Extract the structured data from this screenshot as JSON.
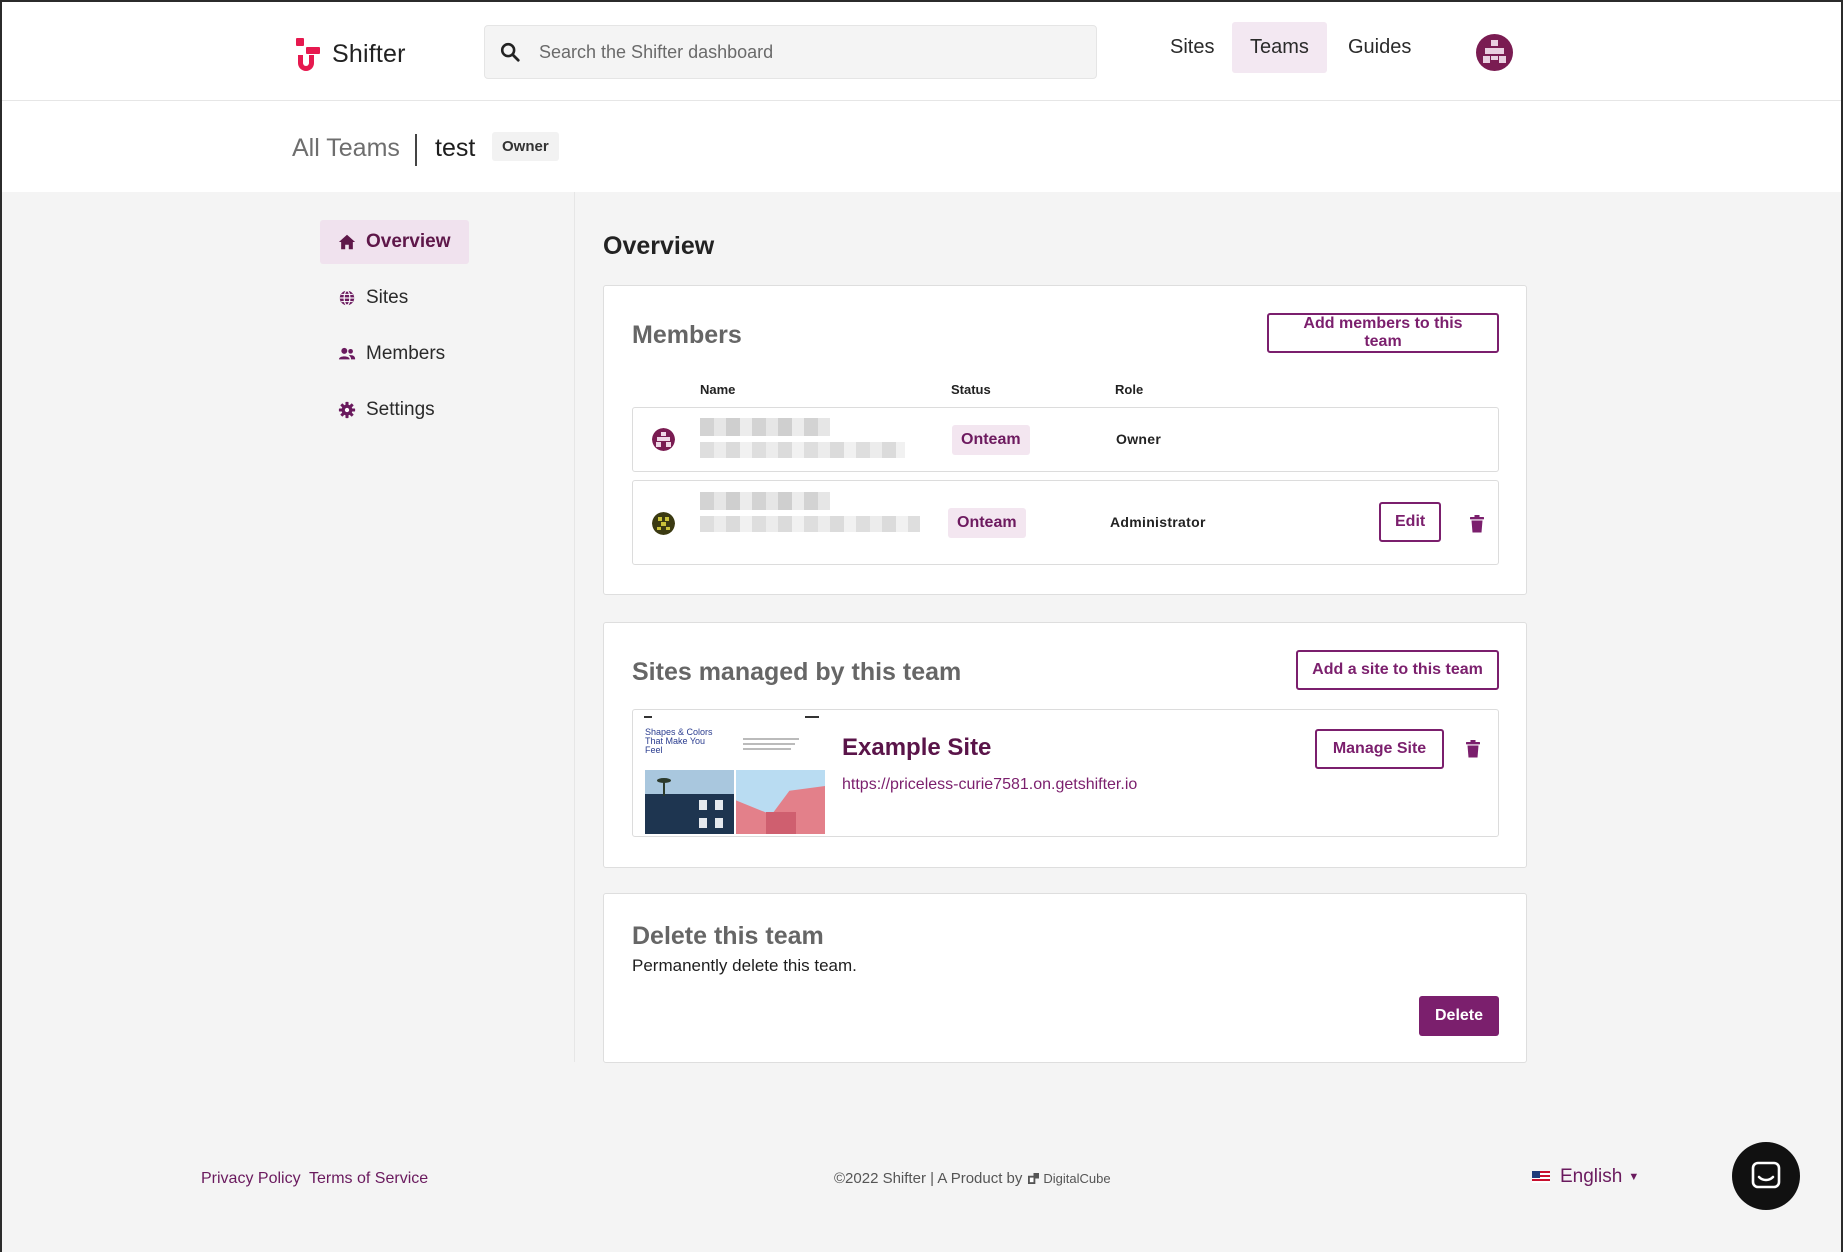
{
  "header": {
    "logo_text": "Shifter",
    "search_placeholder": "Search the Shifter dashboard",
    "nav": {
      "sites": "Sites",
      "teams": "Teams",
      "guides": "Guides"
    }
  },
  "breadcrumb": {
    "all_teams": "All Teams",
    "team_name": "test",
    "role_badge": "Owner"
  },
  "sidebar": {
    "items": [
      {
        "label": "Overview",
        "icon": "home-icon",
        "active": true
      },
      {
        "label": "Sites",
        "icon": "globe-icon",
        "active": false
      },
      {
        "label": "Members",
        "icon": "users-icon",
        "active": false
      },
      {
        "label": "Settings",
        "icon": "gear-icon",
        "active": false
      }
    ]
  },
  "main": {
    "title": "Overview",
    "members": {
      "title": "Members",
      "add_button": "Add members to this team",
      "columns": {
        "name": "Name",
        "status": "Status",
        "role": "Role"
      },
      "rows": [
        {
          "status": "Onteam",
          "role": "Owner"
        },
        {
          "status": "Onteam",
          "role": "Administrator",
          "edit_label": "Edit"
        }
      ]
    },
    "sites": {
      "title": "Sites managed by this team",
      "add_button": "Add a site to this team",
      "items": [
        {
          "name": "Example Site",
          "url": "https://priceless-curie7581.on.getshifter.io",
          "manage_label": "Manage Site",
          "thumb_heading": "Shapes & Colors That Make You Feel"
        }
      ]
    },
    "delete": {
      "title": "Delete this team",
      "description": "Permanently delete this team.",
      "button": "Delete"
    }
  },
  "footer": {
    "privacy": "Privacy Policy",
    "terms": "Terms of Service",
    "copyright": "©2022 Shifter | A Product by",
    "company": "DigitalCube",
    "language": "English"
  },
  "colors": {
    "brand": "#7b1f6d",
    "logo_accent": "#e6194f",
    "active_bg": "#f0e2ee",
    "page_bg": "#f4f4f4"
  }
}
